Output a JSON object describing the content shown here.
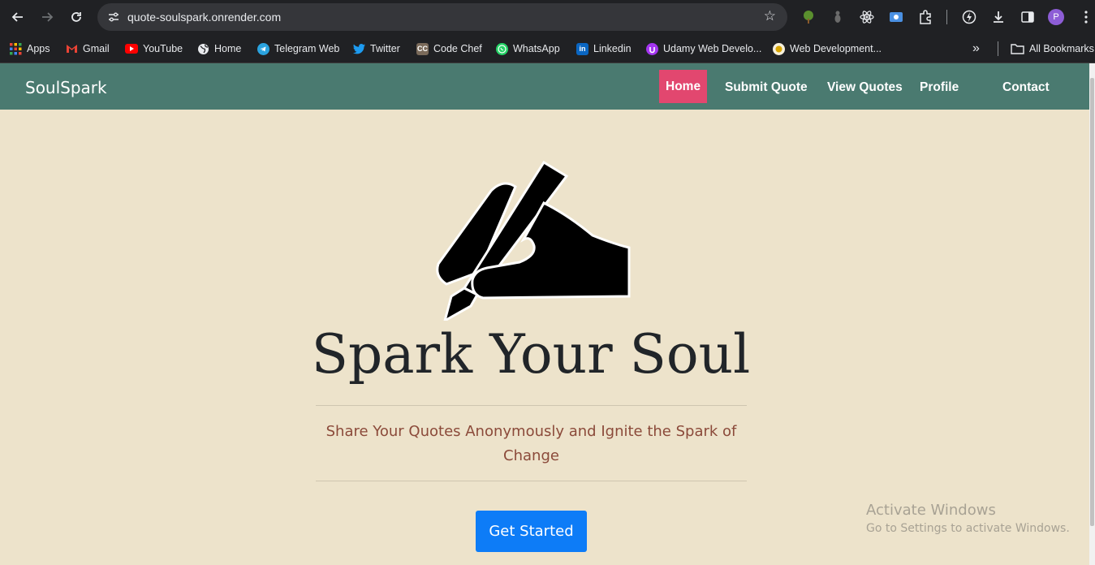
{
  "browser": {
    "url": "quote-soulspark.onrender.com",
    "avatar_letter": "P",
    "bookmarks": [
      {
        "label": "Apps",
        "icon": "apps-grid-icon",
        "color": "#e94235"
      },
      {
        "label": "Gmail",
        "icon": "gmail-icon",
        "color": "#ea4335"
      },
      {
        "label": "YouTube",
        "icon": "youtube-icon",
        "color": "#ff0000"
      },
      {
        "label": "Home",
        "icon": "globe-icon",
        "color": "#e8eaed"
      },
      {
        "label": "Telegram Web",
        "icon": "telegram-icon",
        "color": "#2aa3df"
      },
      {
        "label": "Twitter",
        "icon": "twitter-icon",
        "color": "#1d9bf0"
      },
      {
        "label": "Code Chef",
        "icon": "codechef-icon",
        "color": "#8b6b4a"
      },
      {
        "label": "WhatsApp",
        "icon": "whatsapp-icon",
        "color": "#25d366"
      },
      {
        "label": "Linkedin",
        "icon": "linkedin-icon",
        "color": "#0a66c2"
      },
      {
        "label": "Udamy Web Develo...",
        "icon": "udemy-icon",
        "color": "#a435f0"
      },
      {
        "label": "Web Development...",
        "icon": "web-dev-icon",
        "color": "#f5c542"
      }
    ],
    "all_bookmarks": "All Bookmarks"
  },
  "site": {
    "brand": "SoulSpark",
    "nav": {
      "home": "Home",
      "submit": "Submit Quote",
      "view": "View Quotes",
      "profile": "Profile",
      "contact": "Contact"
    },
    "accent_color": "#e2476f",
    "nav_color": "#4a7a70"
  },
  "hero": {
    "title": "Spark Your Soul",
    "subtitle": "Share Your Quotes Anonymously and Ignite the Spark of Change",
    "cta": "Get Started"
  },
  "watermark": {
    "title": "Activate Windows",
    "subtitle": "Go to Settings to activate Windows."
  }
}
